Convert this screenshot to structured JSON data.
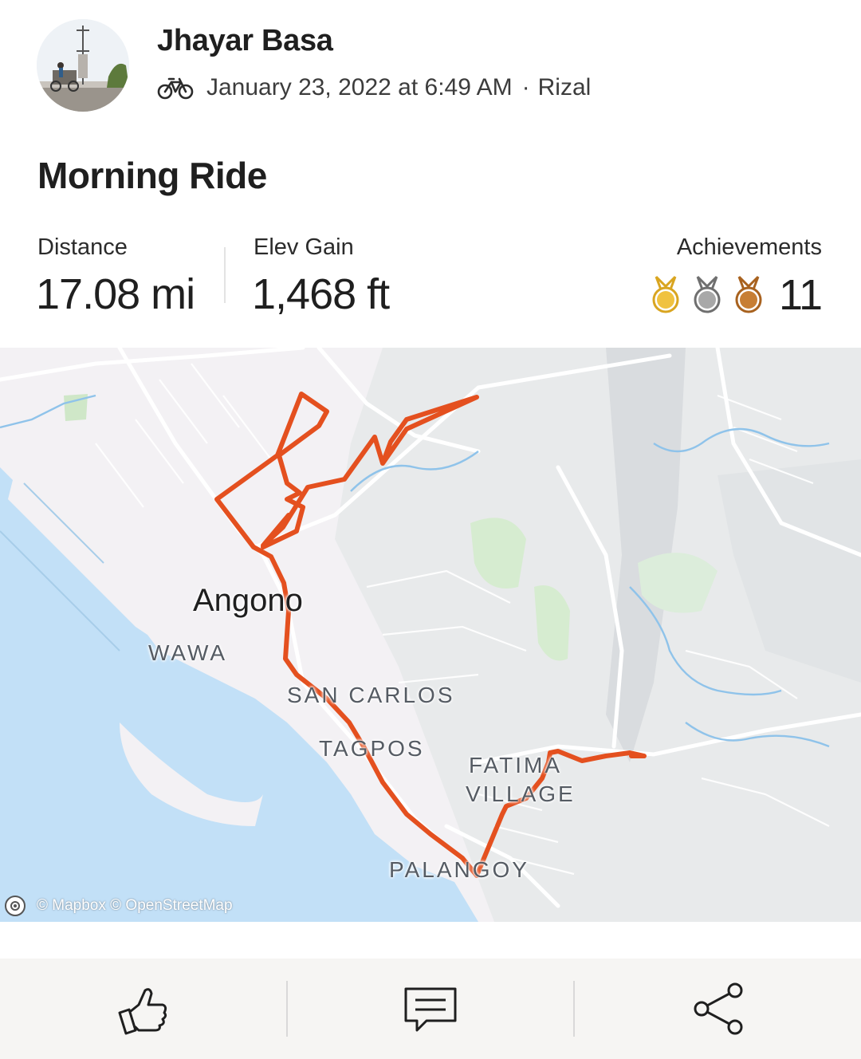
{
  "athlete": {
    "name": "Jhayar Basa",
    "activity_type_icon": "bike-icon",
    "date_time": "January 23, 2022 at 6:49 AM",
    "separator": "·",
    "location": "Rizal"
  },
  "activity": {
    "title": "Morning Ride"
  },
  "stats": {
    "distance": {
      "label": "Distance",
      "value": "17.08 mi"
    },
    "elev_gain": {
      "label": "Elev Gain",
      "value": "1,468 ft"
    },
    "achievements": {
      "label": "Achievements",
      "count": "11",
      "medals": [
        "gold-medal-icon",
        "silver-medal-icon",
        "bronze-medal-icon"
      ]
    }
  },
  "map": {
    "city_label": "Angono",
    "places": [
      "WAWA",
      "SAN CARLOS",
      "TAGPOS",
      "FATIMA",
      "VILLAGE",
      "PALANGOY"
    ],
    "attribution": "© Mapbox © OpenStreetMap",
    "route_color": "#e4501f",
    "water_color": "#c2e0f7",
    "park_color": "#d6ecd0"
  },
  "actions": {
    "kudos_icon": "thumbs-up-icon",
    "comment_icon": "comment-icon",
    "share_icon": "share-icon"
  },
  "colors": {
    "gold": "#f0c240",
    "silver": "#a8a8a8",
    "bronze": "#c77e34"
  }
}
